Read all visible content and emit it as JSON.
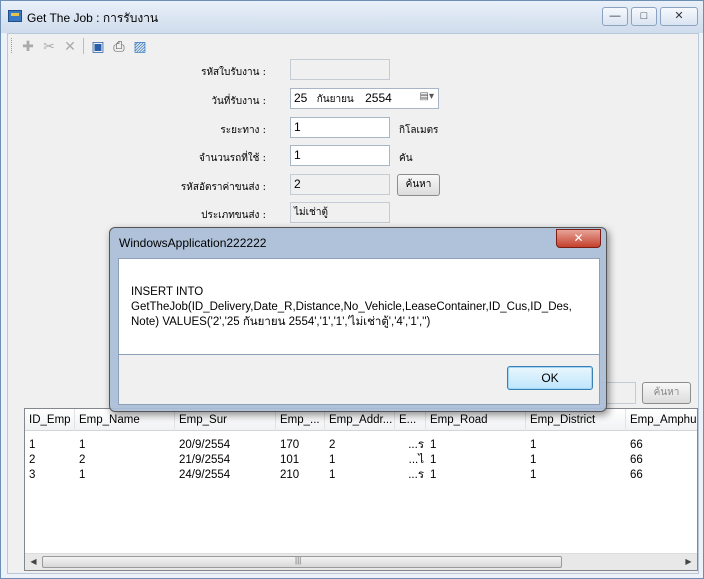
{
  "window": {
    "title": "Get The Job : การรับงาน",
    "minimize": "—",
    "maximize": "□",
    "close": "✕"
  },
  "form": {
    "job_id_label": "รหัสใบรับงาน :",
    "job_id_value": "",
    "date_label": "วันที่รับงาน :",
    "date_day": "25",
    "date_month": "กันยายน",
    "date_year": "2554",
    "distance_label": "ระยะทาง :",
    "distance_value": "1",
    "distance_unit": "กิโลเมตร",
    "vehicles_label": "จำนวนรถที่ใช้ :",
    "vehicles_value": "1",
    "vehicles_unit": "คัน",
    "rate_id_label": "รหัสอัตราค่าขนส่ง :",
    "rate_id_value": "2",
    "search_button": "ค้นหา",
    "transport_type_label": "ประเภทขนส่ง :",
    "transport_type_value": "ไม่เช่าตู้",
    "search_button_2": "ค้นหา"
  },
  "grid": {
    "columns": [
      "ID_Emp",
      "Emp_Name",
      "Emp_Sur",
      "Emp_...",
      "Emp_Addr...",
      "E...",
      "Emp_Road",
      "Emp_District",
      "Emp_Amphu"
    ],
    "rows": [
      [
        "1",
        "1",
        "20/9/2554",
        "170",
        "2",
        "...ร",
        "1",
        "1",
        "66"
      ],
      [
        "2",
        "2",
        "21/9/2554",
        "101",
        "1",
        "...ไ",
        "1",
        "1",
        "66"
      ],
      [
        "3",
        "1",
        "24/9/2554",
        "210",
        "1",
        "...ร",
        "1",
        "1",
        "66"
      ]
    ],
    "scroll_grip": "|||"
  },
  "dialog": {
    "title": "WindowsApplication222222",
    "close": "✕",
    "message": "INSERT INTO\nGetTheJob(ID_Delivery,Date_R,Distance,No_Vehicle,LeaseContainer,ID_Cus,ID_Des,\nNote) VALUES('2','25 กันยายน 2554','1','1','ไม่เช่าตู้','4','1','')",
    "ok": "OK"
  }
}
